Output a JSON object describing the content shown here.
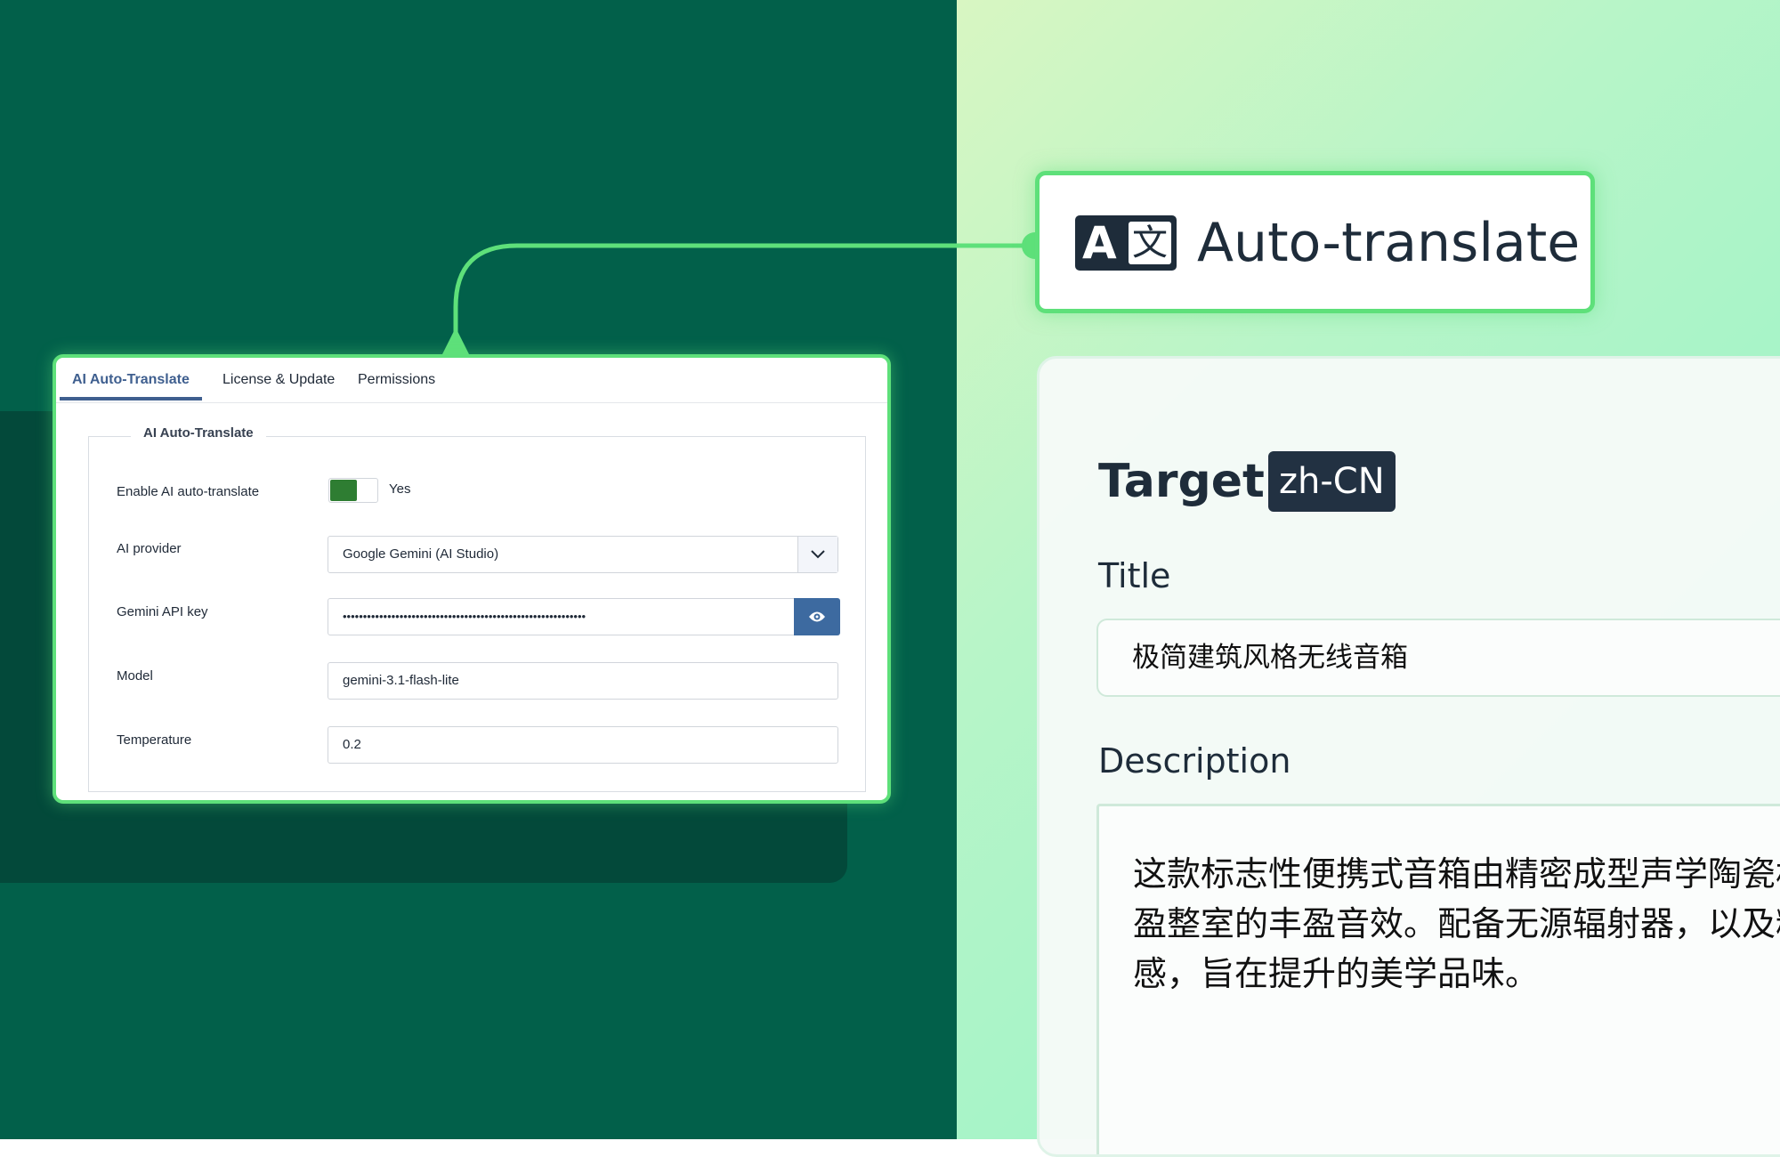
{
  "settings": {
    "tabs": [
      {
        "label": "AI Auto-Translate"
      },
      {
        "label": "License & Update"
      },
      {
        "label": "Permissions"
      }
    ],
    "fieldset_legend": "AI Auto-Translate",
    "enable": {
      "label": "Enable AI auto-translate",
      "value": "Yes"
    },
    "provider": {
      "label": "AI provider",
      "value": "Google Gemini (AI Studio)"
    },
    "api_key": {
      "label": "Gemini API key",
      "value": "••••••••••••••••••••••••••••••••••••••••••••••••••••••••••••"
    },
    "model": {
      "label": "Model",
      "value": "gemini-3.1-flash-lite"
    },
    "temperature": {
      "label": "Temperature",
      "value": "0.2"
    }
  },
  "badge": {
    "icon_letter": "A",
    "icon_glyph": "文",
    "title": "Auto-translate"
  },
  "target": {
    "heading": "Target",
    "language": "zh-CN",
    "title_label": "Title",
    "title_value": "极简建筑风格无线音箱",
    "description_label": "Description",
    "description_value": "这款标志性便携式音箱由精密成型声学陶瓷机身内蕴藏着充盈整室的丰盈音效。配备无源辐射器，以及精致的哑光质感，旨在提升的美学品味。"
  },
  "colors": {
    "left_background": "#02604a",
    "accent_green": "#5ee07a",
    "tab_active": "#3f5f8f",
    "toggle_on": "#2e7d32",
    "eye_button": "#3d6aa0",
    "dark_navy": "#1e2c3a"
  },
  "icons": {
    "select_arrow": "chevron-down-icon",
    "api_key_reveal": "eye-icon",
    "translate": "translate-icon"
  }
}
